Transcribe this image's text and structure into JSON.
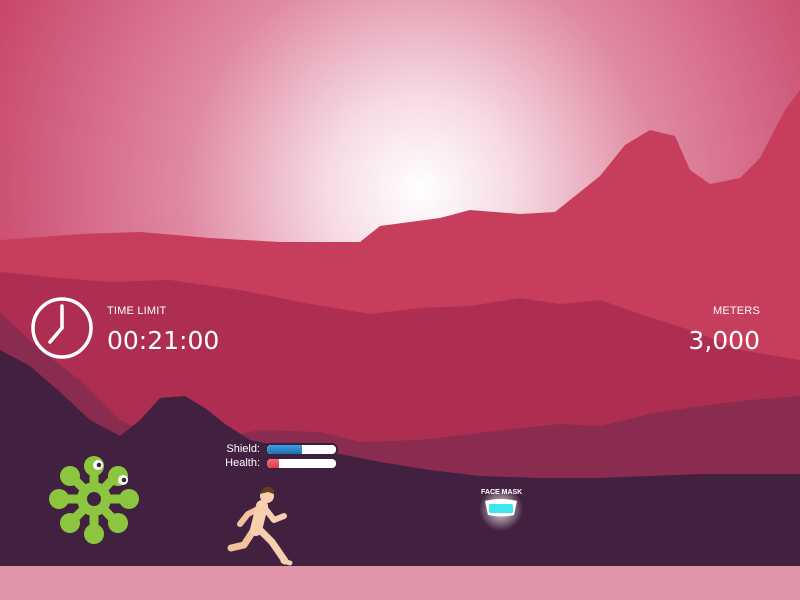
{
  "hud": {
    "time_limit_label": "TIME LIMIT",
    "time_limit_value": "00:21:00",
    "meters_label": "METERS",
    "meters_value": "3,000"
  },
  "player": {
    "shield_label": "Shield:",
    "shield_level": 0.5,
    "health_label": "Health:",
    "health_level": 0.18
  },
  "pickup": {
    "label": "FACE MASK"
  },
  "icons": {
    "clock": "clock-icon",
    "enemy": "virus-icon",
    "pickup": "face-mask-icon"
  },
  "colors": {
    "sky_top": "#c43a5c",
    "sun_glow": "#ffffff",
    "ground": "#e095a8",
    "shield": "#3aa0e0",
    "health": "#e23a4a",
    "virus": "#8cc63f",
    "mask": "#3ee6f0"
  }
}
